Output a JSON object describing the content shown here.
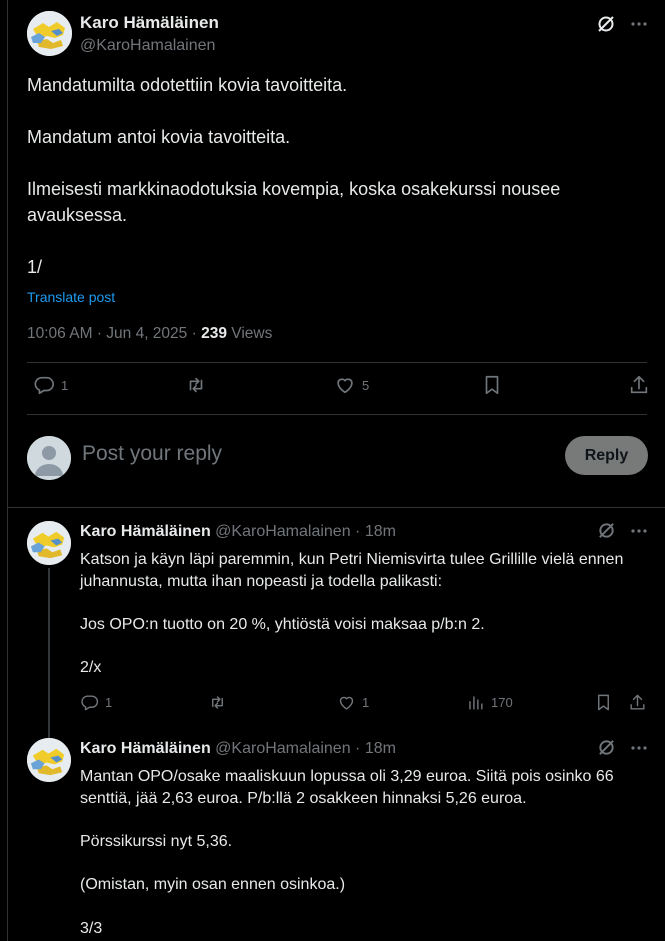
{
  "post": {
    "author_name": "Karo Hämäläinen",
    "author_handle": "@KaroHamalainen",
    "paragraphs": [
      "Mandatumilta odotettiin kovia tavoitteita.",
      "",
      "Mandatum antoi kovia tavoitteita.",
      "",
      "Ilmeisesti markkinaodotuksia kovempia, koska osakekurssi nousee avauksessa.",
      "",
      "1/"
    ],
    "translate_label": "Translate post",
    "time": "10:06 AM",
    "date": "Jun 4, 2025",
    "views_count": "239",
    "views_label": "Views",
    "replies_count": "1",
    "likes_count": "5"
  },
  "composer": {
    "placeholder": "Post your reply",
    "button_label": "Reply"
  },
  "replies": [
    {
      "author_name": "Karo Hämäläinen",
      "author_handle": "@KaroHamalainen",
      "time": "18m",
      "paragraphs": [
        "Katson ja käyn läpi paremmin, kun Petri Niemisvirta tulee Grillille vielä ennen juhannusta, mutta ihan nopeasti ja todella palikasti:",
        "",
        "Jos OPO:n tuotto on 20 %, yhtiöstä voisi maksaa p/b:n 2.",
        "",
        "2/x"
      ],
      "replies_count": "1",
      "likes_count": "1",
      "views_count": "170"
    },
    {
      "author_name": "Karo Hämäläinen",
      "author_handle": "@KaroHamalainen",
      "time": "18m",
      "paragraphs": [
        "Mantan OPO/osake maaliskuun lopussa oli 3,29 euroa. Siitä pois osinko 66 senttiä, jää 2,63 euroa. P/b:llä 2 osakkeen hinnaksi 5,26 euroa.",
        "",
        "Pörssikurssi nyt 5,36.",
        "",
        "(Omistan, myin osan ennen osinkoa.)",
        "",
        "3/3"
      ]
    }
  ],
  "icons": [
    "grok-icon",
    "more-icon",
    "reply-icon",
    "repost-icon",
    "like-icon",
    "bookmark-icon",
    "share-icon",
    "views-icon"
  ],
  "colors": {
    "link": "#1d9bf0",
    "muted": "#71767b",
    "text": "#e7e9ea",
    "background": "#000000",
    "reply_button": "#787a7a"
  }
}
